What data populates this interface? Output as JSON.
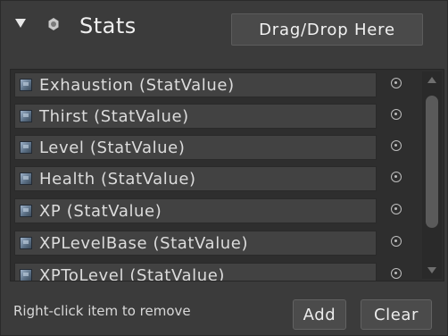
{
  "header": {
    "title": "Stats",
    "drop_label": "Drag/Drop Here"
  },
  "list": {
    "items": [
      {
        "label": "Exhaustion (StatValue)"
      },
      {
        "label": "Thirst (StatValue)"
      },
      {
        "label": "Level (StatValue)"
      },
      {
        "label": "Health (StatValue)"
      },
      {
        "label": "XP (StatValue)"
      },
      {
        "label": "XPLevelBase (StatValue)"
      },
      {
        "label": "XPToLevel (StatValue)"
      }
    ]
  },
  "footer": {
    "hint": "Right-click item to remove",
    "add_label": "Add",
    "clear_label": "Clear"
  },
  "colors": {
    "background": "#3b3b3b",
    "field": "#424242",
    "list_bg": "#2e2e2e",
    "text": "#dcdcdc"
  }
}
